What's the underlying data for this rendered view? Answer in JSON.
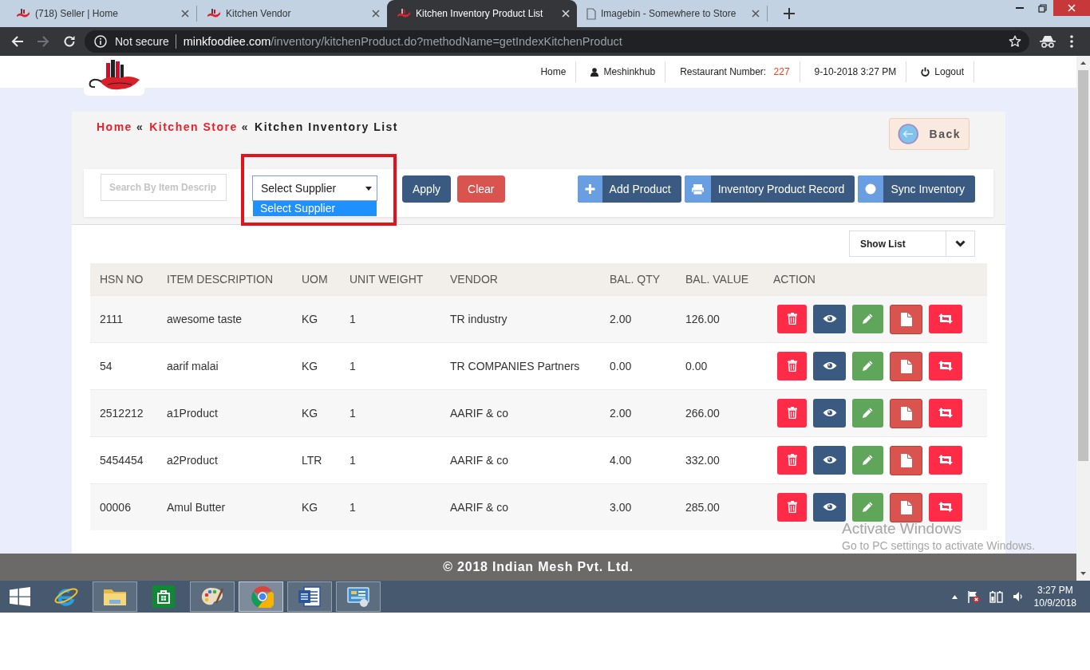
{
  "browser": {
    "tabs": [
      {
        "title": "(718) Seller | Home",
        "kind": "site",
        "selected": false
      },
      {
        "title": "Kitchen Vendor",
        "kind": "site",
        "selected": false
      },
      {
        "title": "Kitchen Inventory Product List",
        "kind": "site",
        "selected": true
      },
      {
        "title": "Imagebin - Somewhere to Store",
        "kind": "page",
        "selected": false
      }
    ],
    "forward_enabled": false,
    "address": {
      "security": "Not secure",
      "host": "minkfoodiee.com",
      "path": "/inventory/kitchenProduct.do?methodName=getIndexKitchenProduct"
    }
  },
  "header": {
    "nav": [
      {
        "kind": "link",
        "label": "Home"
      },
      {
        "kind": "user",
        "label": "Meshinkhub"
      },
      {
        "kind": "restaurant",
        "label": "Restaurant Number:",
        "value": "227"
      },
      {
        "kind": "datetime",
        "label": "9-10-2018 3:27 PM"
      },
      {
        "kind": "logout",
        "label": "Logout"
      }
    ]
  },
  "breadcrumb": [
    {
      "label": "Home",
      "current": false,
      "separator": "«"
    },
    {
      "label": "Kitchen Store",
      "current": false,
      "separator": "«"
    },
    {
      "label": "Kitchen Inventory List",
      "current": true
    }
  ],
  "back_button": {
    "label": "Back"
  },
  "filters": {
    "search": {
      "placeholder": "Search By Item Descrip"
    },
    "supplier": {
      "value": "Select Supplier",
      "expanded": true,
      "options": [
        {
          "label": "Select Supplier",
          "selected": true
        }
      ]
    },
    "buttons": [
      {
        "kind": "apply",
        "label": "Apply"
      },
      {
        "kind": "clear",
        "label": "Clear"
      }
    ],
    "actions": [
      {
        "kind": "add",
        "label": "Add Product"
      },
      {
        "kind": "print",
        "label": "Inventory Product Record"
      },
      {
        "kind": "sync",
        "label": "Sync Inventory"
      }
    ]
  },
  "view_select": {
    "label": "Show List"
  },
  "table": {
    "columns": [
      "HSN NO",
      "ITEM DESCRIPTION",
      "UOM",
      "UNIT WEIGHT",
      "VENDOR",
      "BAL. QTY",
      "BAL. VALUE",
      "ACTION"
    ],
    "rows": [
      [
        "2111",
        "awesome taste",
        "KG",
        "1",
        "TR industry",
        "2.00",
        "126.00"
      ],
      [
        "54",
        "aarif malai",
        "KG",
        "1",
        "TR COMPANIES Partners",
        "0.00",
        "0.00"
      ],
      [
        "2512212",
        "a1Product",
        "KG",
        "1",
        "AARIF & co",
        "2.00",
        "266.00"
      ],
      [
        "5454454",
        "a2Product",
        "LTR",
        "1",
        "AARIF & co",
        "4.00",
        "332.00"
      ],
      [
        "00006",
        "Amul Butter",
        "KG",
        "1",
        "AARIF & co",
        "3.00",
        "285.00"
      ]
    ]
  },
  "footer": {
    "text": "© 2018 Indian Mesh Pvt. Ltd."
  },
  "activation_notice": {
    "title": "Activate Windows",
    "message": "Go to PC settings to activate Windows."
  },
  "taskbar": {
    "apps": [
      {
        "kind": "ie",
        "running": false,
        "selected": false
      },
      {
        "kind": "explorer",
        "running": true,
        "selected": false
      },
      {
        "kind": "store",
        "running": false,
        "selected": false
      },
      {
        "kind": "paint",
        "running": true,
        "selected": false
      },
      {
        "kind": "chrome",
        "running": true,
        "selected": true
      },
      {
        "kind": "word",
        "running": true,
        "selected": false
      },
      {
        "kind": "control",
        "running": true,
        "selected": false
      }
    ],
    "clock": {
      "time": "3:27 PM",
      "date": "10/9/2018"
    }
  }
}
